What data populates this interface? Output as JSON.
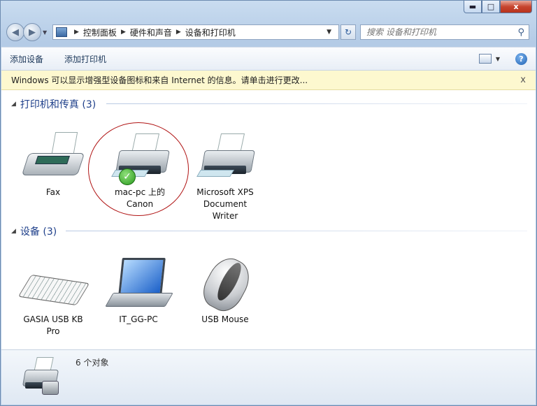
{
  "window": {
    "controls": {
      "minimize": "▬",
      "maximize": "□",
      "close": "x"
    }
  },
  "nav": {
    "breadcrumb": [
      "控制面板",
      "硬件和声音",
      "设备和打印机"
    ],
    "search_placeholder": "搜索 设备和打印机"
  },
  "toolbar": {
    "add_device": "添加设备",
    "add_printer": "添加打印机",
    "help": "?"
  },
  "infobar": {
    "message": "Windows 可以显示增强型设备图标和来自 Internet 的信息。请单击进行更改...",
    "close": "x"
  },
  "groups": {
    "printers": {
      "header": "打印机和传真 (3)",
      "items": [
        {
          "label_lines": [
            "Fax"
          ]
        },
        {
          "label_lines": [
            "mac-pc 上的",
            "Canon"
          ],
          "default": true
        },
        {
          "label_lines": [
            "Microsoft XPS",
            "Document",
            "Writer"
          ]
        }
      ]
    },
    "devices": {
      "header": "设备 (3)",
      "items": [
        {
          "label_lines": [
            "GASIA USB KB",
            "Pro"
          ]
        },
        {
          "label_lines": [
            "IT_GG-PC"
          ]
        },
        {
          "label_lines": [
            "USB Mouse"
          ]
        }
      ]
    }
  },
  "details": {
    "count": "6 个对象"
  },
  "icons": {
    "back": "back-arrow-icon",
    "forward": "forward-arrow-icon",
    "refresh": "refresh-icon",
    "search": "search-icon",
    "help": "help-icon",
    "check": "default-check-icon"
  }
}
